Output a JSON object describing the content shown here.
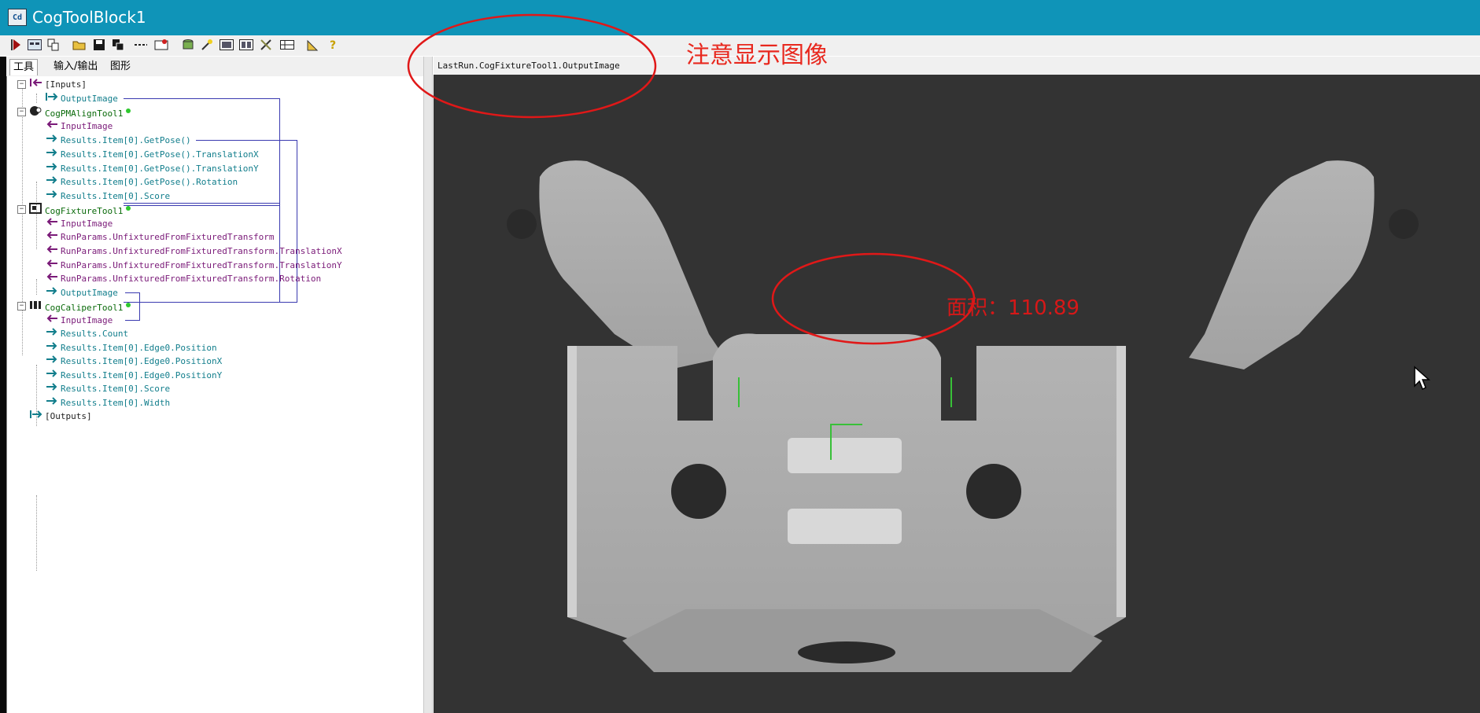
{
  "window": {
    "title": "CogToolBlock1",
    "icon_text": "Cd"
  },
  "toolbar": {
    "icons": [
      "run-icon",
      "grid-icon",
      "copy-icon",
      "open-icon",
      "save-icon",
      "save-as-icon",
      "dashed-icon",
      "record-icon",
      "database-icon",
      "wand-icon",
      "image-icon",
      "image2-icon",
      "tools-icon",
      "table-icon",
      "ruler-icon",
      "help-icon"
    ]
  },
  "tabs": [
    "工具",
    "输入/输出",
    "图形"
  ],
  "tree": {
    "inputs": "[Inputs]",
    "inputs_output_image": "OutputImage",
    "pm_tool": "CogPMAlignTool1",
    "pm_items": [
      "InputImage",
      "Results.Item[0].GetPose()",
      "Results.Item[0].GetPose().TranslationX",
      "Results.Item[0].GetPose().TranslationY",
      "Results.Item[0].GetPose().Rotation",
      "Results.Item[0].Score"
    ],
    "fixture_tool": "CogFixtureTool1",
    "fixture_items": [
      "InputImage",
      "RunParams.UnfixturedFromFixturedTransform",
      "RunParams.UnfixturedFromFixturedTransform.TranslationX",
      "RunParams.UnfixturedFromFixturedTransform.TranslationY",
      "RunParams.UnfixturedFromFixturedTransform.Rotation",
      "OutputImage"
    ],
    "caliper_tool": "CogCaliperTool1",
    "caliper_items": [
      "InputImage",
      "Results.Count",
      "Results.Item[0].Edge0.Position",
      "Results.Item[0].Edge0.PositionX",
      "Results.Item[0].Edge0.PositionY",
      "Results.Item[0].Score",
      "Results.Item[0].Width"
    ],
    "outputs": "[Outputs]"
  },
  "image_view": {
    "caption": "LastRun.CogFixtureTool1.OutputImage",
    "annotation": "注意显示图像",
    "area_text": "面积：110.89"
  },
  "colors": {
    "titlebar": "#0f94b8",
    "annotation": "#e8281e",
    "teal": "#127e8c",
    "purple": "#7a1a78"
  }
}
